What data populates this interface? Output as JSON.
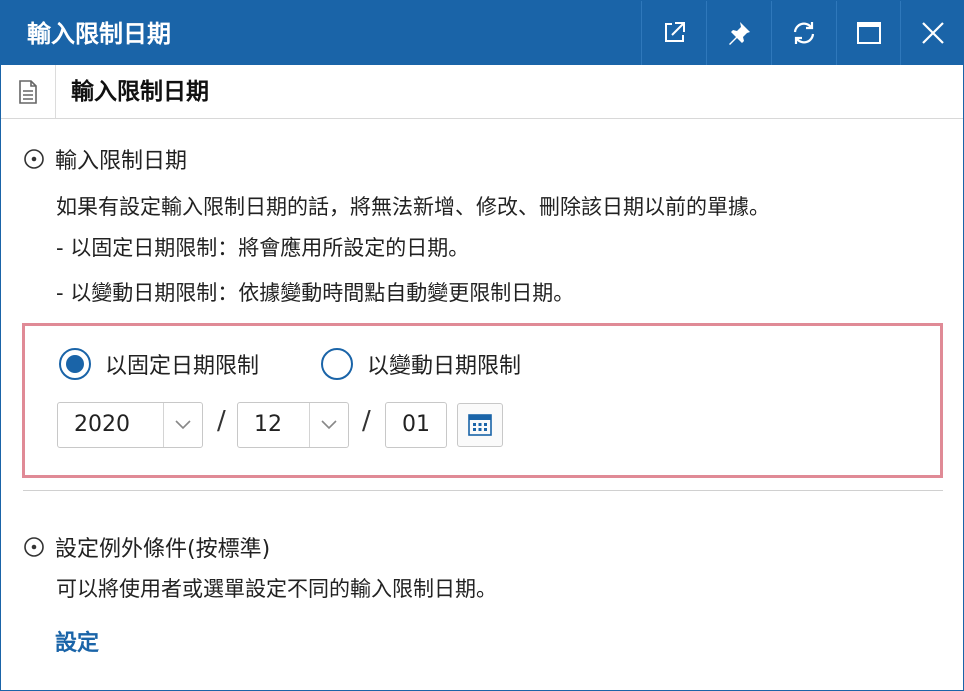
{
  "window": {
    "title": "輸入限制日期",
    "buttons": [
      "popout-icon",
      "pin-icon",
      "refresh-icon",
      "maximize-icon",
      "close-icon"
    ]
  },
  "subheader": {
    "title": "輸入限制日期",
    "icon": "document-icon"
  },
  "section1": {
    "heading": "輸入限制日期",
    "description": "如果有設定輸入限制日期的話，將無法新增、修改、刪除該日期以前的單據。",
    "fixed_note": "- 以固定日期限制：將會應用所設定的日期。",
    "variable_note": "- 以變動日期限制：依據變動時間點自動變更限制日期。"
  },
  "options": {
    "fixed_label": "以固定日期限制",
    "variable_label": "以變動日期限制",
    "selected": "fixed"
  },
  "date": {
    "year": "2020",
    "month": "12",
    "day": "01",
    "separator": "/"
  },
  "section2": {
    "heading": "設定例外條件(按標準)",
    "description": "可以將使用者或選單設定不同的輸入限制日期。",
    "link_label": "設定"
  },
  "colors": {
    "accent": "#1a64a8",
    "highlight_border": "#e08a96"
  }
}
